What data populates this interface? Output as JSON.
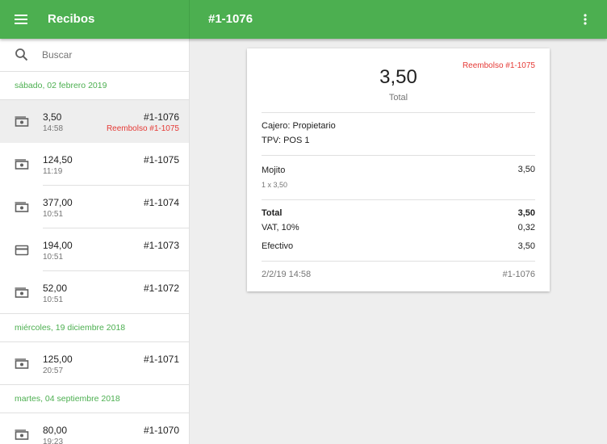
{
  "appbar": {
    "title": "Recibos",
    "detail_title": "#1-1076",
    "color": "#4caf50"
  },
  "search": {
    "placeholder": "Buscar",
    "value": ""
  },
  "groups": [
    {
      "date": "sábado, 02 febrero 2019",
      "receipts": [
        {
          "amount": "3,50",
          "time": "14:58",
          "number": "#1-1076",
          "refund": "Reembolso #1-1075",
          "icon": "cash-icon",
          "selected": true
        },
        {
          "amount": "124,50",
          "time": "11:19",
          "number": "#1-1075",
          "refund": "",
          "icon": "cash-icon"
        },
        {
          "amount": "377,00",
          "time": "10:51",
          "number": "#1-1074",
          "refund": "",
          "icon": "cash-icon"
        },
        {
          "amount": "194,00",
          "time": "10:51",
          "number": "#1-1073",
          "refund": "",
          "icon": "card-icon"
        },
        {
          "amount": "52,00",
          "time": "10:51",
          "number": "#1-1072",
          "refund": "",
          "icon": "cash-icon"
        }
      ]
    },
    {
      "date": "miércoles, 19 diciembre 2018",
      "receipts": [
        {
          "amount": "125,00",
          "time": "20:57",
          "number": "#1-1071",
          "refund": "",
          "icon": "cash-icon"
        }
      ]
    },
    {
      "date": "martes, 04 septiembre 2018",
      "receipts": [
        {
          "amount": "80,00",
          "time": "19:23",
          "number": "#1-1070",
          "refund": "",
          "icon": "cash-icon"
        }
      ]
    }
  ],
  "detail": {
    "refund_tag": "Reembolso  #1-1075",
    "amount": "3,50",
    "total_label": "Total",
    "cashier": "Cajero: Propietario",
    "pos": "TPV: POS 1",
    "item": {
      "name": "Mojito",
      "price": "3,50",
      "qty": "1 x 3,50"
    },
    "total": {
      "label": "Total",
      "value": "3,50"
    },
    "vat": {
      "label": "VAT,  10%",
      "value": "0,32"
    },
    "payment": {
      "label": "Efectivo",
      "value": "3,50"
    },
    "footer": {
      "date": "2/2/19 14:58",
      "number": "#1-1076"
    }
  },
  "colors": {
    "accent": "#4caf50",
    "refund": "#e53935",
    "selected_row": "#eeeeee"
  }
}
